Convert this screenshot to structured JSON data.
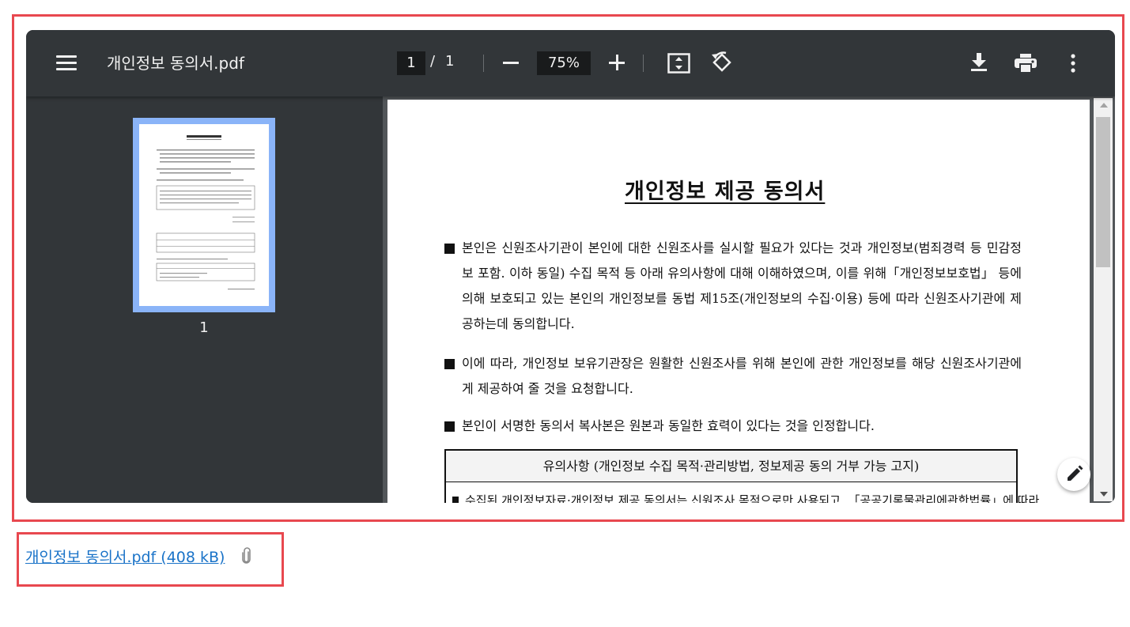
{
  "viewer": {
    "title": "개인정보 동의서.pdf",
    "current_page": "1",
    "page_separator": "/",
    "total_pages": "1",
    "zoom": "75%",
    "icons": [
      "menu-icon",
      "zoom-out-icon",
      "zoom-in-icon",
      "fit-page-icon",
      "rotate-icon",
      "download-icon",
      "print-icon",
      "more-icon",
      "edit-icon"
    ]
  },
  "sidebar": {
    "thumbnail_page_number": "1"
  },
  "document": {
    "heading": "개인정보 제공 동의서",
    "paragraphs": [
      "본인은 신원조사기관이 본인에 대한 신원조사를 실시할 필요가 있다는 것과 개인정보(범죄경력 등 민감정보 포함. 이하 동일) 수집 목적 등 아래 유의사항에 대해 이해하였으며, 이를 위해「개인정보보호법」 등에 의해 보호되고 있는 본인의 개인정보를 동법 제15조(개인정보의 수집·이용) 등에 따라 신원조사기관에 제공하는데 동의합니다.",
      "이에 따라, 개인정보 보유기관장은 원활한 신원조사를 위해 본인에 관한 개인정보를 해당 신원조사기관에게 제공하여 줄 것을 요청합니다.",
      "본인이 서명한 동의서 복사본은 원본과 동일한 효력이 있다는 것을 인정합니다."
    ],
    "notice_heading": "유의사항 (개인정보 수집 목적·관리방법, 정보제공 동의 거부 가능 고지)",
    "notice_first_line": "수집된 개인정보자료·개인정보 제공 동의서는 신원조사 목적으로만 사용되고, 「공공기록물관리에관한법률」에 따라"
  },
  "attachment": {
    "link_text": "개인정보 동의서.pdf (408 kB)",
    "icon": "paperclip-icon"
  },
  "colors": {
    "toolbar_bg": "#323639",
    "content_bg": "#525659",
    "thumbnail_selected": "#8ab4f8",
    "highlight_border": "#e8484f",
    "link": "#1a73c8"
  }
}
